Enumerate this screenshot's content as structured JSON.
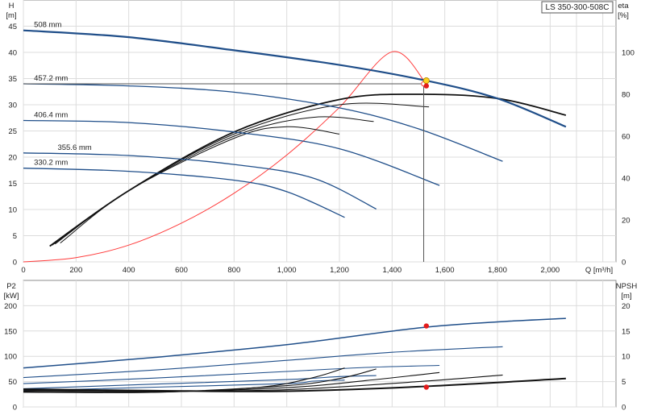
{
  "chart_data": [
    {
      "type": "line",
      "title": "",
      "model": "LS 350-300-508C",
      "xlabel": "Q [m³/h]",
      "ylabel_left": "H",
      "ylabel_left_unit": "[m]",
      "ylabel_right": "eta",
      "ylabel_right_unit": "[%]",
      "xlim": [
        0,
        2250
      ],
      "ylim_left": [
        0,
        50
      ],
      "ylim_right": [
        0,
        125
      ],
      "x_ticks": [
        0,
        200,
        400,
        600,
        800,
        1000,
        1200,
        1400,
        1600,
        1800,
        2000
      ],
      "x_tick_labels": [
        "0",
        "200",
        "400",
        "600",
        "800",
        "1,000",
        "1,200",
        "1,400",
        "1,600",
        "1,800",
        "2,000"
      ],
      "y_left_ticks": [
        0,
        5,
        10,
        15,
        20,
        25,
        30,
        35,
        40,
        45
      ],
      "y_right_ticks": [
        0,
        20,
        40,
        60,
        80,
        100
      ],
      "grid": true,
      "head_curves": [
        {
          "name": "508 mm",
          "points": [
            [
              0,
              44.2
            ],
            [
              400,
              42.9
            ],
            [
              800,
              40.4
            ],
            [
              1200,
              37.6
            ],
            [
              1530,
              34.6
            ],
            [
              1800,
              31.2
            ],
            [
              2060,
              25.8
            ]
          ]
        },
        {
          "name": "457.2 mm",
          "points": [
            [
              0,
              34.0
            ],
            [
              400,
              33.6
            ],
            [
              800,
              32.4
            ],
            [
              1200,
              29.4
            ],
            [
              1500,
              25.4
            ],
            [
              1820,
              19.2
            ]
          ]
        },
        {
          "name": "406.4 mm",
          "points": [
            [
              0,
              27.0
            ],
            [
              400,
              26.6
            ],
            [
              800,
              24.8
            ],
            [
              1200,
              21.6
            ],
            [
              1580,
              14.6
            ]
          ]
        },
        {
          "name": "355.6 mm",
          "points": [
            [
              0,
              20.8
            ],
            [
              400,
              20.3
            ],
            [
              800,
              18.6
            ],
            [
              1100,
              16.0
            ],
            [
              1340,
              10.1
            ]
          ]
        },
        {
          "name": "330.2 mm",
          "points": [
            [
              0,
              17.9
            ],
            [
              400,
              17.3
            ],
            [
              800,
              15.6
            ],
            [
              1000,
              13.4
            ],
            [
              1220,
              8.5
            ]
          ]
        }
      ],
      "efficiency_curves": [
        {
          "points": [
            [
              100,
              7.5
            ],
            [
              400,
              34
            ],
            [
              800,
              62
            ],
            [
              1200,
              77.5
            ],
            [
              1500,
              80
            ],
            [
              1800,
              78
            ],
            [
              2060,
              70
            ]
          ]
        },
        {
          "points": [
            [
              110,
              8
            ],
            [
              400,
              34
            ],
            [
              800,
              61
            ],
            [
              1200,
              75
            ],
            [
              1540,
              74
            ]
          ]
        },
        {
          "points": [
            [
              120,
              8.5
            ],
            [
              400,
              34
            ],
            [
              800,
              60
            ],
            [
              1100,
              69
            ],
            [
              1330,
              67
            ]
          ]
        },
        {
          "points": [
            [
              140,
              9
            ],
            [
              400,
              34
            ],
            [
              800,
              59
            ],
            [
              1000,
              64.5
            ],
            [
              1200,
              61
            ]
          ]
        }
      ],
      "system_curve": {
        "points": [
          [
            0,
            0
          ],
          [
            200,
            0.8
          ],
          [
            400,
            3.2
          ],
          [
            600,
            7.4
          ],
          [
            800,
            13.1
          ],
          [
            1000,
            20.4
          ],
          [
            1200,
            29.5
          ],
          [
            1400,
            40.1
          ],
          [
            1530,
            34.0
          ]
        ]
      },
      "operating_point": {
        "x": 1530,
        "h": 34.6,
        "eta": 84
      },
      "intersection_line": {
        "x": 1520,
        "h": 34.0
      }
    },
    {
      "type": "line",
      "title": "",
      "xlabel": "",
      "ylabel_left": "P2",
      "ylabel_left_unit": "[kW]",
      "ylabel_right": "NPSH",
      "ylabel_right_unit": "[m]",
      "xlim": [
        0,
        2250
      ],
      "ylim_left": [
        0,
        250
      ],
      "ylim_right": [
        0,
        25
      ],
      "y_left_ticks": [
        0,
        50,
        100,
        150,
        200
      ],
      "y_right_ticks": [
        0,
        5,
        10,
        15,
        20
      ],
      "grid": true,
      "power_curves": [
        {
          "points": [
            [
              0,
              77
            ],
            [
              500,
              98
            ],
            [
              1000,
              123
            ],
            [
              1500,
              156
            ],
            [
              1800,
              168
            ],
            [
              2060,
              175
            ]
          ]
        },
        {
          "points": [
            [
              0,
              58
            ],
            [
              500,
              73
            ],
            [
              1000,
              92
            ],
            [
              1400,
              108
            ],
            [
              1820,
              119
            ]
          ]
        },
        {
          "points": [
            [
              0,
              46
            ],
            [
              500,
              57
            ],
            [
              1000,
              70
            ],
            [
              1300,
              78
            ],
            [
              1580,
              82
            ]
          ]
        },
        {
          "points": [
            [
              0,
              36
            ],
            [
              500,
              45
            ],
            [
              1000,
              54
            ],
            [
              1200,
              60
            ],
            [
              1340,
              62
            ]
          ]
        },
        {
          "points": [
            [
              0,
              32
            ],
            [
              500,
              39
            ],
            [
              1000,
              46
            ],
            [
              1100,
              51
            ],
            [
              1220,
              53
            ]
          ]
        }
      ],
      "npsh_curves": [
        {
          "points": [
            [
              0,
              3.5
            ],
            [
              500,
              3.2
            ],
            [
              1000,
              3.1
            ],
            [
              1500,
              4.0
            ],
            [
              2060,
              5.6
            ]
          ]
        },
        {
          "points": [
            [
              0,
              3.3
            ],
            [
              500,
              3.1
            ],
            [
              1000,
              3.4
            ],
            [
              1500,
              5.0
            ],
            [
              1820,
              6.3
            ]
          ]
        },
        {
          "points": [
            [
              0,
              3.1
            ],
            [
              500,
              3.0
            ],
            [
              1000,
              3.8
            ],
            [
              1300,
              5.2
            ],
            [
              1580,
              6.8
            ]
          ]
        },
        {
          "points": [
            [
              0,
              3.0
            ],
            [
              500,
              2.9
            ],
            [
              1000,
              4.2
            ],
            [
              1200,
              5.6
            ],
            [
              1340,
              7.5
            ]
          ]
        },
        {
          "points": [
            [
              0,
              2.9
            ],
            [
              500,
              2.9
            ],
            [
              900,
              3.9
            ],
            [
              1100,
              5.8
            ],
            [
              1220,
              7.7
            ]
          ]
        }
      ],
      "operating_point_power": {
        "x": 1530,
        "p2": 160
      },
      "operating_point_npsh": {
        "x": 1530,
        "npsh": 3.9
      }
    }
  ]
}
